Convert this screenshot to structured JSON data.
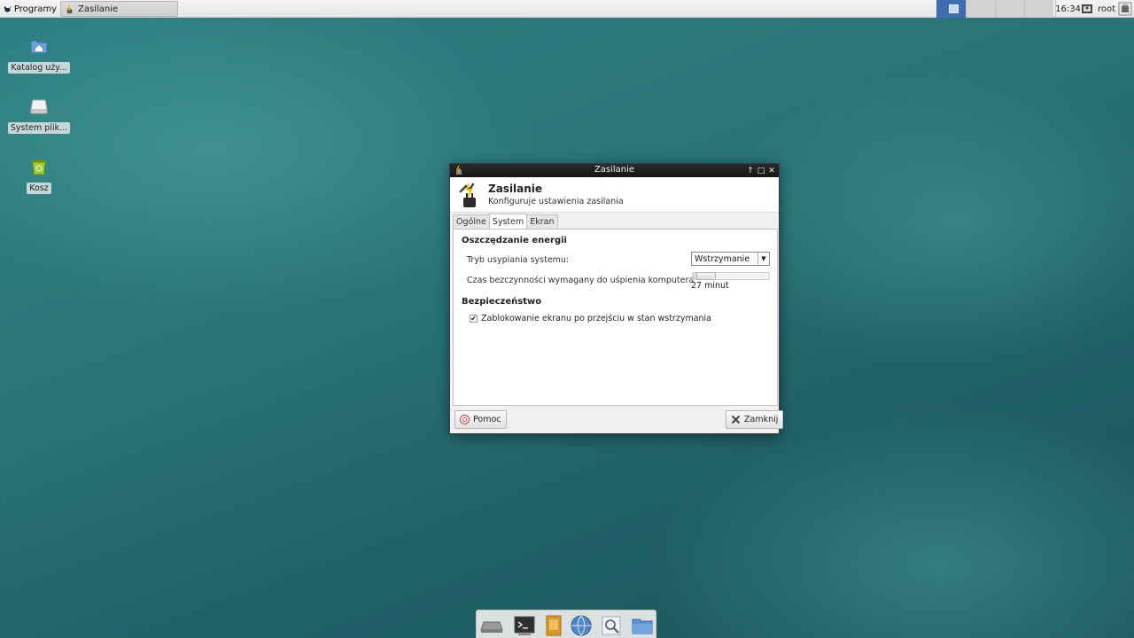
{
  "top_panel": {
    "apps_menu_label": "Programy",
    "taskbar_item": "Zasilanie",
    "clock": "16:34",
    "user": "root"
  },
  "desktop_icons": [
    {
      "label": "Katalog uży...",
      "icon": "home-folder-icon"
    },
    {
      "label": "System plik...",
      "icon": "drive-icon"
    },
    {
      "label": "Kosz",
      "icon": "trash-icon"
    }
  ],
  "window": {
    "title": "Zasilanie",
    "header_title": "Zasilanie",
    "header_subtitle": "Konfiguruje ustawienia zasilania",
    "tabs": [
      {
        "label": "Ogólne",
        "active": false
      },
      {
        "label": "System",
        "active": true
      },
      {
        "label": "Ekran",
        "active": false
      }
    ],
    "energy_section": "Oszczędzanie energii",
    "sleep_mode_label": "Tryb usypiania systemu:",
    "sleep_mode_value": "Wstrzymanie",
    "idle_label": "Czas bezczynności wymagany do uśpienia komputera",
    "idle_value": "27 minut",
    "idle_fraction": 0.07,
    "security_section": "Bezpieczeństwo",
    "lock_label": "Zablokowanie ekranu po przejściu w stan wstrzymania",
    "lock_checked": true,
    "help_button": "Pomoc",
    "close_button": "Zamknij"
  },
  "dock_items": [
    "drive-icon",
    "terminal-icon",
    "file-manager-icon",
    "web-browser-icon",
    "search-icon",
    "folder-icon"
  ],
  "colors": {
    "active_workspace": "#3f6cb3",
    "titlebar": "#1e1e1e",
    "desktop": "#2a7477"
  }
}
